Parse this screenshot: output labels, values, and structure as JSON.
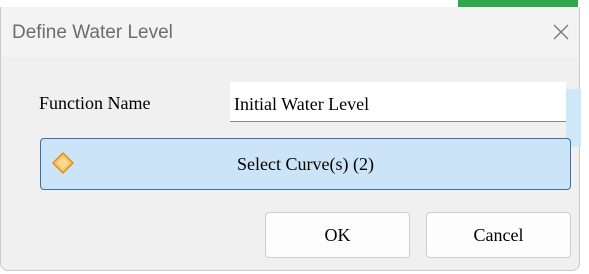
{
  "window": {
    "title": "Define Water Level",
    "close_icon": "close-icon"
  },
  "form": {
    "function_name_label": "Function Name",
    "function_name_value": "Initial Water Level"
  },
  "select_curves": {
    "label": "Select Curve(s) (2)",
    "icon": "diamond-icon"
  },
  "buttons": {
    "ok": "OK",
    "cancel": "Cancel"
  },
  "colors": {
    "select_button_bg": "#cce4f7",
    "select_button_border": "#3d6fa3",
    "diamond_icon": "#f5a623",
    "accent_strip": "#2ea84a"
  }
}
